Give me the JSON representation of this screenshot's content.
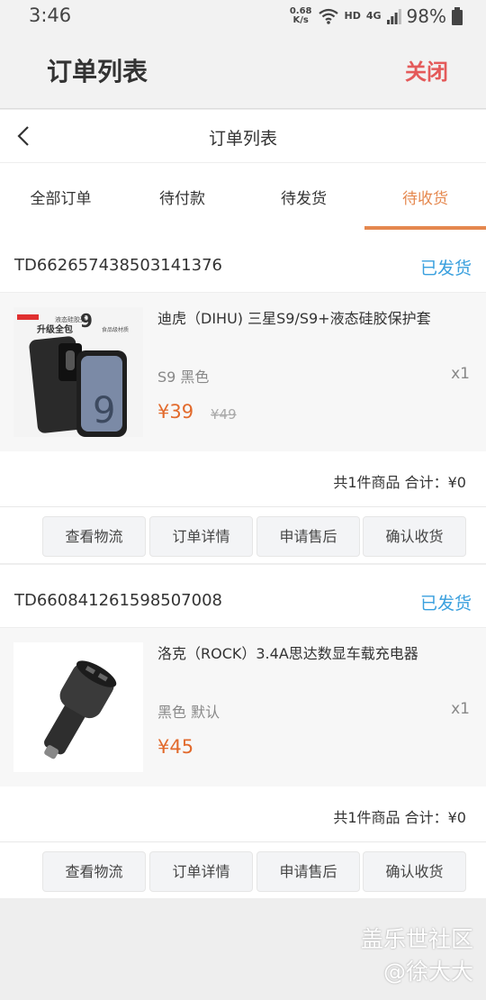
{
  "status_bar": {
    "time": "3:46",
    "net_speed_value": "0.68",
    "net_speed_unit": "K/s",
    "hd": "HD",
    "network": "4G",
    "battery": "98%"
  },
  "app_bar": {
    "title": "订单列表",
    "close_label": "关闭"
  },
  "nav_bar": {
    "title": "订单列表"
  },
  "tabs": [
    {
      "label": "全部订单",
      "active": false
    },
    {
      "label": "待付款",
      "active": false
    },
    {
      "label": "待发货",
      "active": false
    },
    {
      "label": "待收货",
      "active": true
    }
  ],
  "orders": [
    {
      "order_no": "TD662657438503141376",
      "status": "已发货",
      "product_name": "迪虎（DIHU) 三星S9/S9+液态硅胶保护套",
      "spec": "S9 黑色",
      "qty": "x1",
      "price": "¥39",
      "original_price": "¥49",
      "image_text": {
        "line1": "液态硅胶壳",
        "line2": "升级全包",
        "line3": "9",
        "line4": "食品级材质"
      },
      "summary": "共1件商品 合计：¥0",
      "buttons": [
        "查看物流",
        "订单详情",
        "申请售后",
        "确认收货"
      ]
    },
    {
      "order_no": "TD660841261598507008",
      "status": "已发货",
      "product_name": "洛克（ROCK）3.4A思达数显车载充电器",
      "spec": "黑色 默认",
      "qty": "x1",
      "price": "¥45",
      "summary": "共1件商品 合计：¥0",
      "buttons": [
        "查看物流",
        "订单详情",
        "申请售后",
        "确认收货"
      ]
    }
  ],
  "watermark": {
    "line1": "盖乐世社区",
    "line2": "@徐大大"
  },
  "colors": {
    "accent": "#e5884f",
    "status_blue": "#3aa0de",
    "close_red": "#e45a5a",
    "price": "#e26a2c"
  }
}
